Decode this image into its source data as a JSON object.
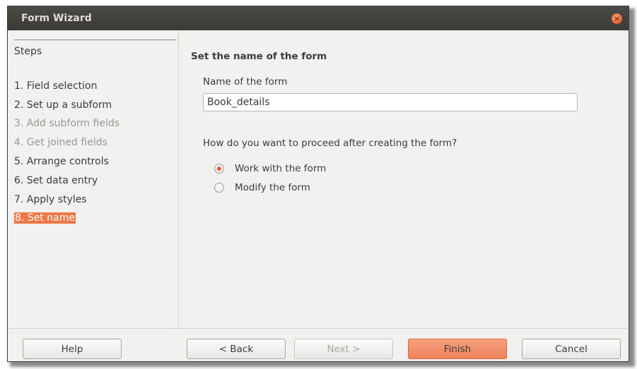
{
  "window": {
    "title": "Form Wizard",
    "close_glyph": "×"
  },
  "steps": {
    "heading": "Steps",
    "items": [
      {
        "label": "1. Field selection"
      },
      {
        "label": "2. Set up a subform"
      },
      {
        "label": "3. Add subform fields"
      },
      {
        "label": "4. Get joined fields"
      },
      {
        "label": "5. Arrange controls"
      },
      {
        "label": "6. Set data entry"
      },
      {
        "label": "7. Apply styles"
      },
      {
        "label": "8. Set name"
      }
    ]
  },
  "main": {
    "section_title": "Set the name of the form",
    "name_label": "Name of the form",
    "name_value": "Book_details",
    "question": "How do you want to proceed after creating the form?",
    "options": [
      {
        "label": "Work with the form",
        "selected": true
      },
      {
        "label": "Modify the form",
        "selected": false
      }
    ]
  },
  "buttons": {
    "help": "Help",
    "back": "< Back",
    "next": "Next >",
    "finish": "Finish",
    "cancel": "Cancel"
  },
  "colors": {
    "accent": "#f07746",
    "titlebar": "#3c3b37"
  }
}
